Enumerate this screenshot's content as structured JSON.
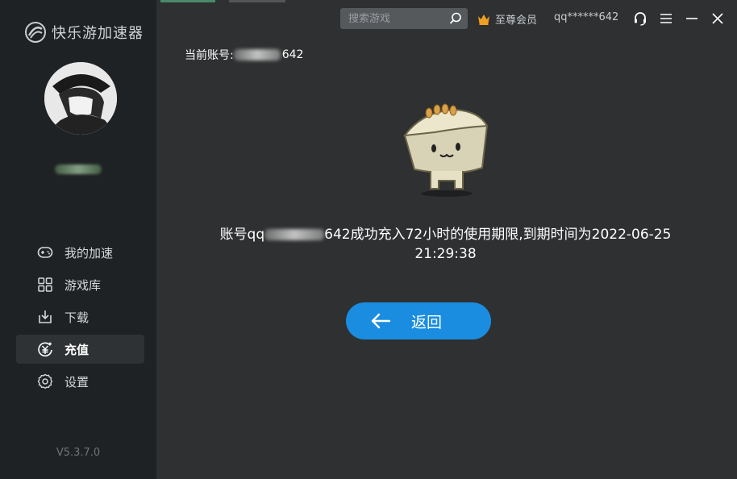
{
  "app": {
    "name": "快乐游加速器",
    "version": "V5.3.7.0"
  },
  "profile": {
    "nickname": ""
  },
  "nav": {
    "items": [
      {
        "label": "我的加速",
        "icon": "gamepad-icon",
        "active": false
      },
      {
        "label": "游戏库",
        "icon": "grid-icon",
        "active": false
      },
      {
        "label": "下载",
        "icon": "download-icon",
        "active": false
      },
      {
        "label": "充值",
        "icon": "yuan-recharge-icon",
        "active": true
      },
      {
        "label": "设置",
        "icon": "gear-icon",
        "active": false
      }
    ]
  },
  "header": {
    "search_placeholder": "搜索游戏",
    "vip_label": "至尊会员",
    "user_id": "qq******642"
  },
  "main": {
    "account_label": "当前账号:",
    "account_suffix": "642",
    "message_prefix": "账号qq",
    "message_suffix": "642成功充入72小时的使用期限,到期时间为2022-06-25",
    "message_time": "21:29:38",
    "back_label": "返回"
  },
  "colors": {
    "accent": "#1a8de0",
    "sidebar_bg": "#1f2224",
    "main_bg": "#2e3031",
    "vip_crown": "#f0a020"
  }
}
